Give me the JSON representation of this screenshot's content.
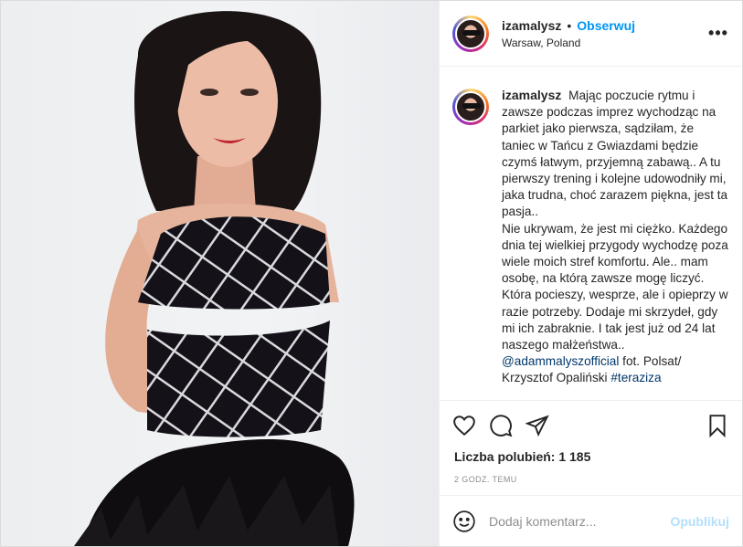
{
  "post": {
    "username": "izamalysz",
    "follow_label": "Obserwuj",
    "separator": "•",
    "location": "Warsaw, Poland",
    "more_label": "•••",
    "photo_alt": "izamalysz"
  },
  "caption": {
    "username": "izamalysz",
    "text": "Mając poczucie rytmu i zawsze podczas imprez wychodząc na parkiet jako pierwsza, sądziłam, że taniec w Tańcu z Gwiazdami będzie czymś łatwym, przyjemną zabawą.. A tu pierwszy trening i kolejne udowodniły mi, jaka trudna, choć zarazem piękna, jest ta pasja..",
    "text2": "Nie ukrywam, że jest mi ciężko. Każdego dnia tej wielkiej przygody wychodzę poza wiele moich stref komfortu. Ale.. mam osobę, na którą zawsze mogę liczyć. Która pocieszy, wesprze, ale i opieprzy w razie potrzeby. Dodaje mi skrzydeł, gdy mi ich zabraknie. I tak jest już od 24 lat naszego małżeństwa..",
    "mention": "@adammalyszofficial",
    "credit": " fot. Polsat/ Krzysztof Opaliński ",
    "hashtag": "#teraziza"
  },
  "stats": {
    "likes": "Liczba polubień: 1 185",
    "time": "2 GODZ. TEMU"
  },
  "comment_box": {
    "placeholder": "Dodaj komentarz...",
    "publish": "Opublikuj"
  },
  "icons": {
    "like": "heart-icon",
    "comment": "comment-icon",
    "share": "share-icon",
    "save": "bookmark-icon",
    "emoji": "emoji-icon",
    "more": "more-icon"
  }
}
